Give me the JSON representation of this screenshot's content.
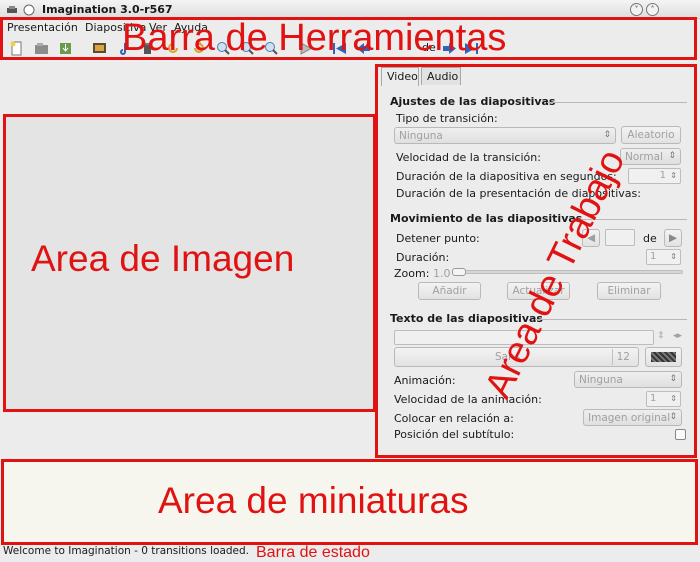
{
  "window": {
    "title": "Imagination 3.0-r567",
    "controls": [
      "minimize-icon",
      "maximize-icon"
    ]
  },
  "menu": {
    "items": [
      {
        "label": "Presentación"
      },
      {
        "label": "Diapositiva"
      },
      {
        "label": "Ver"
      },
      {
        "label": "Ayuda"
      }
    ]
  },
  "toolbar": {
    "icons": [
      "new-icon",
      "open-icon",
      "save-icon",
      "import-pictures-icon",
      "import-audio-icon",
      "delete-icon",
      "rotate-left-icon",
      "rotate-right-icon",
      "zoom-in-icon",
      "zoom-out-icon",
      "zoom-fit-icon",
      "preview-icon",
      "first-slide-icon",
      "previous-slide-icon",
      "next-slide-icon",
      "last-slide-icon"
    ],
    "page_of": "de"
  },
  "annotations": {
    "toolbar": "Barra de Herramientas",
    "image_area": "Area de Imagen",
    "work_area": "Area de Trabajo",
    "thumbnails": "Area de miniaturas",
    "statusbar": "Barra de estado",
    "color": "#e11212"
  },
  "notebook": {
    "tabs": [
      {
        "label": "Video",
        "active": true
      },
      {
        "label": "Audio",
        "active": false
      }
    ]
  },
  "slide_settings": {
    "title": "Ajustes de las diapositivas",
    "transition_type_label": "Tipo de transición:",
    "transition_value": "Ninguna",
    "random_button": "Aleatorio",
    "transition_speed_label": "Velocidad de la transición:",
    "transition_speed_value": "Normal",
    "slide_duration_label": "Duración de la diapositiva en segundos:",
    "slide_duration_value": "1",
    "presentation_duration_label": "Duración de la presentación de diapositivas:"
  },
  "slide_motion": {
    "title": "Movimiento de las diapositivas",
    "stop_point_label": "Detener punto:",
    "of_label": "de",
    "duration_label": "Duración:",
    "duration_value": "1",
    "zoom_label": "Zoom:",
    "zoom_value": "1.0",
    "add_button": "Añadir",
    "update_button": "Actualizar",
    "remove_button": "Eliminar"
  },
  "slide_text": {
    "title": "Texto de las diapositivas",
    "font_name": "Sans",
    "font_size": "12",
    "animation_label": "Animación:",
    "animation_value": "Ninguna",
    "anim_speed_label": "Velocidad de la animación:",
    "anim_speed_value": "1",
    "placing_label": "Colocar en relación a:",
    "placing_value": "Imagen original",
    "subtitle_pos_label": "Posición del subtítulo:"
  },
  "status": {
    "text": "Welcome to Imagination - 0 transitions loaded."
  }
}
